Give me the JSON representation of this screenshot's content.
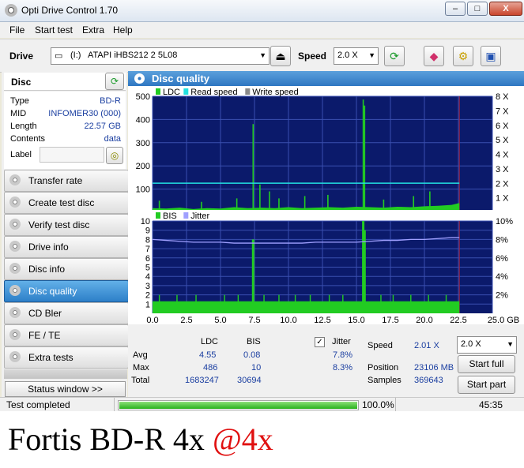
{
  "window": {
    "title": "Opti Drive Control 1.70",
    "controls": {
      "minimize": "–",
      "maximize": "□",
      "close": "X"
    }
  },
  "menu": [
    "File",
    "Start test",
    "Extra",
    "Help"
  ],
  "toolbar": {
    "drive_label": "Drive",
    "drive_letter": "(I:)",
    "drive_value": "ATAPI iHBS212   2 5L08",
    "speed_label": "Speed",
    "speed_value": "2.0 X",
    "icons": [
      "eject-icon",
      "refresh-icon",
      "eraser-icon",
      "gear-icon",
      "save-icon"
    ]
  },
  "disc": {
    "header": "Disc",
    "fields": [
      {
        "key": "Type",
        "value": "BD-R"
      },
      {
        "key": "MID",
        "value": "INFOMER30 (000)"
      },
      {
        "key": "Length",
        "value": "22.57 GB"
      },
      {
        "key": "Contents",
        "value": "data"
      }
    ],
    "label_key": "Label",
    "label_value": ""
  },
  "nav": [
    {
      "label": "Transfer rate",
      "active": false
    },
    {
      "label": "Create test disc",
      "active": false
    },
    {
      "label": "Verify test disc",
      "active": false
    },
    {
      "label": "Drive info",
      "active": false
    },
    {
      "label": "Disc info",
      "active": false
    },
    {
      "label": "Disc quality",
      "active": true
    },
    {
      "label": "CD Bler",
      "active": false
    },
    {
      "label": "FE / TE",
      "active": false
    },
    {
      "label": "Extra tests",
      "active": false
    }
  ],
  "status_window_button": "Status window >>",
  "panel_title": "Disc quality",
  "colors": {
    "plot_bg": "#0b1a6b",
    "ldc": "#22cc22",
    "read_speed": "#22e0e0",
    "bis": "#22cc22",
    "jitter": "#a0a0ff",
    "grid": "#3a4fb0",
    "header_blue": "#2f77c2"
  },
  "chart_data": [
    {
      "type": "area",
      "legend": [
        "LDC",
        "Read speed",
        "Write speed"
      ],
      "x_ticks": [
        "0.0",
        "2.5",
        "5.0",
        "7.5",
        "10.0",
        "12.5",
        "15.0",
        "17.5",
        "20.0",
        "22.5",
        "25.0 GB"
      ],
      "y_ticks_left": [
        "100",
        "200",
        "300",
        "400",
        "500"
      ],
      "y_ticks_right": [
        "1 X",
        "2 X",
        "3 X",
        "4 X",
        "5 X",
        "6 X",
        "7 X",
        "8 X"
      ],
      "xlim": [
        0,
        25
      ],
      "ylim_left": [
        0,
        500
      ],
      "ylim_right": [
        0,
        8
      ],
      "ldc_baseline": [
        [
          0.0,
          18
        ],
        [
          1.0,
          16
        ],
        [
          2.0,
          20
        ],
        [
          3.0,
          14
        ],
        [
          4.0,
          18
        ],
        [
          5.0,
          16
        ],
        [
          6.0,
          22
        ],
        [
          7.0,
          18
        ],
        [
          8.0,
          20
        ],
        [
          9.0,
          18
        ],
        [
          10.0,
          22
        ],
        [
          11.0,
          18
        ],
        [
          12.0,
          20
        ],
        [
          13.0,
          22
        ],
        [
          14.0,
          20
        ],
        [
          15.0,
          24
        ],
        [
          16.0,
          22
        ],
        [
          17.0,
          20
        ],
        [
          18.0,
          24
        ],
        [
          19.0,
          22
        ],
        [
          20.0,
          26
        ],
        [
          21.0,
          28
        ],
        [
          22.0,
          32
        ],
        [
          22.57,
          40
        ]
      ],
      "ldc_spikes": [
        [
          0.5,
          50
        ],
        [
          3.6,
          45
        ],
        [
          6.2,
          60
        ],
        [
          7.4,
          380
        ],
        [
          7.9,
          120
        ],
        [
          8.6,
          90
        ],
        [
          9.3,
          60
        ],
        [
          11.2,
          70
        ],
        [
          12.9,
          75
        ],
        [
          15.5,
          486
        ],
        [
          15.6,
          460
        ],
        [
          17.0,
          55
        ],
        [
          19.2,
          70
        ],
        [
          20.4,
          90
        ]
      ],
      "read_speed": [
        [
          0.0,
          2.01
        ],
        [
          22.57,
          2.01
        ]
      ]
    },
    {
      "type": "area",
      "legend": [
        "BIS",
        "Jitter"
      ],
      "x_ticks": [
        "0.0",
        "2.5",
        "5.0",
        "7.5",
        "10.0",
        "12.5",
        "15.0",
        "17.5",
        "20.0",
        "22.5",
        "25.0 GB"
      ],
      "y_ticks_left": [
        "1",
        "2",
        "3",
        "4",
        "5",
        "6",
        "7",
        "8",
        "9",
        "10"
      ],
      "y_ticks_right": [
        "2%",
        "4%",
        "6%",
        "8%",
        "10%"
      ],
      "xlim": [
        0,
        25
      ],
      "ylim_left": [
        0,
        10
      ],
      "ylim_right": [
        0,
        10
      ],
      "bis_level": 1.3,
      "bis_spikes": [
        [
          0.5,
          2
        ],
        [
          1.8,
          2
        ],
        [
          3.2,
          2
        ],
        [
          5.3,
          2
        ],
        [
          6.3,
          2
        ],
        [
          7.4,
          8
        ],
        [
          8.2,
          2
        ],
        [
          9.3,
          2
        ],
        [
          10.5,
          2
        ],
        [
          11.6,
          2
        ],
        [
          13.0,
          2
        ],
        [
          14.0,
          2
        ],
        [
          15.5,
          10
        ],
        [
          15.6,
          9
        ],
        [
          16.8,
          2
        ],
        [
          17.7,
          2
        ],
        [
          19.0,
          2
        ],
        [
          20.3,
          2
        ],
        [
          21.6,
          2
        ]
      ],
      "jitter": [
        [
          0.0,
          8.0
        ],
        [
          1.0,
          7.9
        ],
        [
          2.0,
          7.8
        ],
        [
          3.0,
          7.7
        ],
        [
          4.0,
          7.7
        ],
        [
          5.0,
          7.7
        ],
        [
          6.0,
          7.6
        ],
        [
          7.0,
          7.6
        ],
        [
          8.0,
          7.6
        ],
        [
          9.0,
          7.6
        ],
        [
          10.0,
          7.6
        ],
        [
          11.0,
          7.6
        ],
        [
          12.0,
          7.7
        ],
        [
          13.0,
          7.7
        ],
        [
          14.0,
          7.7
        ],
        [
          15.0,
          7.7
        ],
        [
          16.0,
          7.8
        ],
        [
          17.0,
          7.9
        ],
        [
          18.0,
          7.9
        ],
        [
          19.0,
          8.0
        ],
        [
          20.0,
          8.0
        ],
        [
          21.0,
          8.1
        ],
        [
          22.0,
          8.2
        ],
        [
          22.57,
          8.2
        ]
      ]
    }
  ],
  "stats": {
    "headers": [
      "LDC",
      "BIS"
    ],
    "rows": [
      {
        "label": "Avg",
        "ldc": "4.55",
        "bis": "0.08",
        "jitter": "7.8%"
      },
      {
        "label": "Max",
        "ldc": "486",
        "bis": "10",
        "jitter": "8.3%"
      },
      {
        "label": "Total",
        "ldc": "1683247",
        "bis": "30694"
      }
    ],
    "jitter_checked": true,
    "jitter_label": "Jitter",
    "speed_label": "Speed",
    "speed_value": "2.01 X",
    "position_label": "Position",
    "position_value": "23106 MB",
    "samples_label": "Samples",
    "samples_value": "369643",
    "speed_select": "2.0 X",
    "start_full": "Start full",
    "start_part": "Start part"
  },
  "statusbar": {
    "text": "Test completed",
    "progress": 1.0,
    "progress_text": "100.0%",
    "time": "45:35"
  },
  "caption": {
    "main": "Fortis BD-R 4x",
    "highlight": "@4x",
    "highlight_color": "#e01010"
  }
}
